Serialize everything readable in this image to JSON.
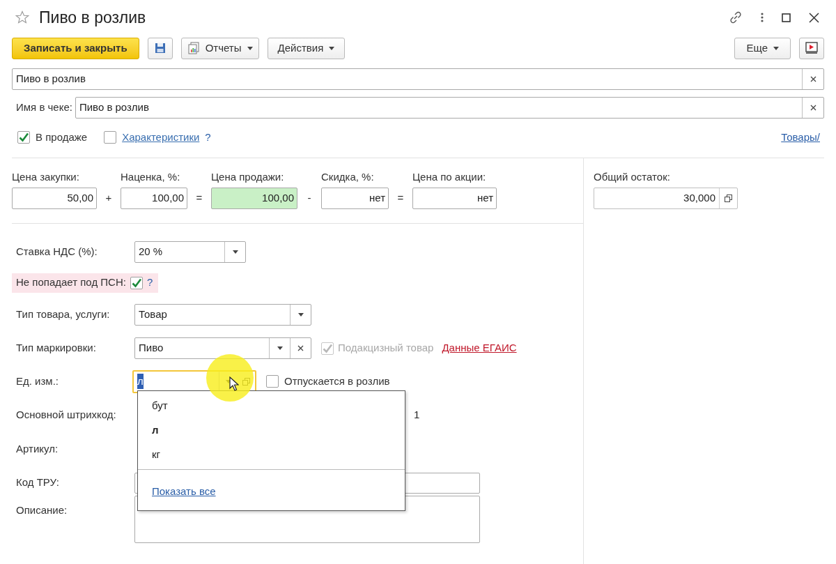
{
  "window": {
    "title": "Пиво в розлив",
    "favorite": false
  },
  "toolbar": {
    "primary": "Записать и закрыть",
    "reports": "Отчеты",
    "actions": "Действия",
    "more": "Еще"
  },
  "name_field": {
    "value": "Пиво в розлив"
  },
  "receipt_name": {
    "label": "Имя в чеке:",
    "value": "Пиво в розлив"
  },
  "flags": [
    {
      "kind": "text",
      "label": "В продаже",
      "checked": true
    },
    {
      "kind": "link",
      "label": "Характеристики",
      "checked": false,
      "help": "?"
    }
  ],
  "nav_link": "Товары/",
  "prices": [
    {
      "label": "Цена закупки:",
      "value": "50,00",
      "highlighted": false,
      "operator": "+"
    },
    {
      "label": "Наценка, %:",
      "value": "100,00",
      "highlighted": false,
      "operator": "="
    },
    {
      "label": "Цена продажи:",
      "value": "100,00",
      "highlighted": true,
      "operator": "-"
    },
    {
      "label": "Скидка, %:",
      "value": "нет",
      "highlighted": false,
      "operator": "="
    },
    {
      "label": "Цена по акции:",
      "value": "нет",
      "highlighted": false
    }
  ],
  "stock": {
    "label": "Общий остаток:",
    "value": "30,000"
  },
  "vat": {
    "label": "Ставка НДС (%):",
    "value": "20 %"
  },
  "psn": {
    "label": "Не попадает под ПСН:",
    "checked": true,
    "help": "?"
  },
  "product_type": {
    "label": "Тип товара, услуги:",
    "value": "Товар"
  },
  "marking": {
    "label": "Тип маркировки:",
    "value": "Пиво",
    "excise": {
      "label": "Подакцизный товар",
      "checked": true,
      "disabled": true
    },
    "link": "Данные ЕГАИС"
  },
  "unit": {
    "label": "Ед. изм.:",
    "value": "л",
    "focused": true,
    "draft": {
      "label": "Отпускается в розлив",
      "checked": false
    }
  },
  "unit_dropdown": {
    "items": [
      {
        "label": "бут",
        "selected": false
      },
      {
        "label": "л",
        "selected": true
      },
      {
        "label": "кг",
        "selected": false
      }
    ],
    "show_all": "Показать все"
  },
  "barcode": {
    "label": "Основной штрихкод:",
    "value_tail": "1"
  },
  "article": {
    "label": "Артикул:"
  },
  "tru": {
    "label": "Код ТРУ:"
  },
  "description": {
    "label": "Описание:"
  }
}
